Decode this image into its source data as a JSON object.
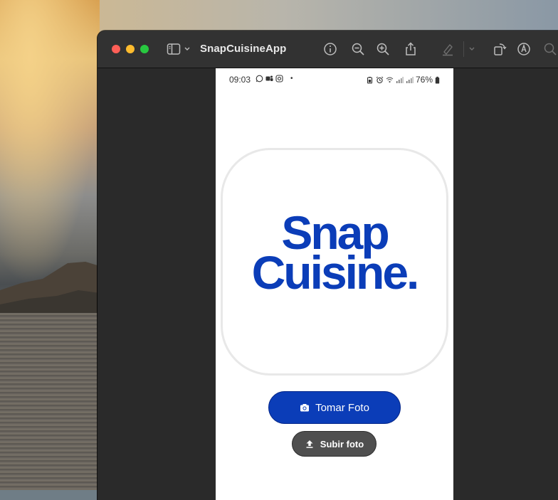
{
  "window": {
    "title": "SnapCuisineApp",
    "toolbar_icons": [
      "sidebar-icon",
      "chevron-down-icon",
      "info-icon",
      "zoom-out-icon",
      "zoom-in-icon",
      "share-icon",
      "highlight-icon",
      "chevron-down-icon",
      "rotate-icon",
      "markup-icon",
      "search-icon"
    ]
  },
  "phone": {
    "status_bar": {
      "time": "09:03",
      "app_icons": [
        "whatsapp-icon",
        "teams-icon",
        "instagram-icon"
      ],
      "dot": "•",
      "battery_percent": "76%",
      "right_icons": [
        "battery-saver-icon",
        "alarm-icon",
        "wifi-icon",
        "signal-icon",
        "signal-icon",
        "battery-icon"
      ]
    },
    "logo": {
      "line1": "Snap",
      "line2": "Cuisine."
    },
    "buttons": {
      "take_photo": "Tomar Foto",
      "upload_photo": "Subir foto"
    }
  },
  "colors": {
    "brand": "#0b3db8",
    "secondary_button": "#4f4f4f",
    "window_bg": "#2a2a2a"
  }
}
